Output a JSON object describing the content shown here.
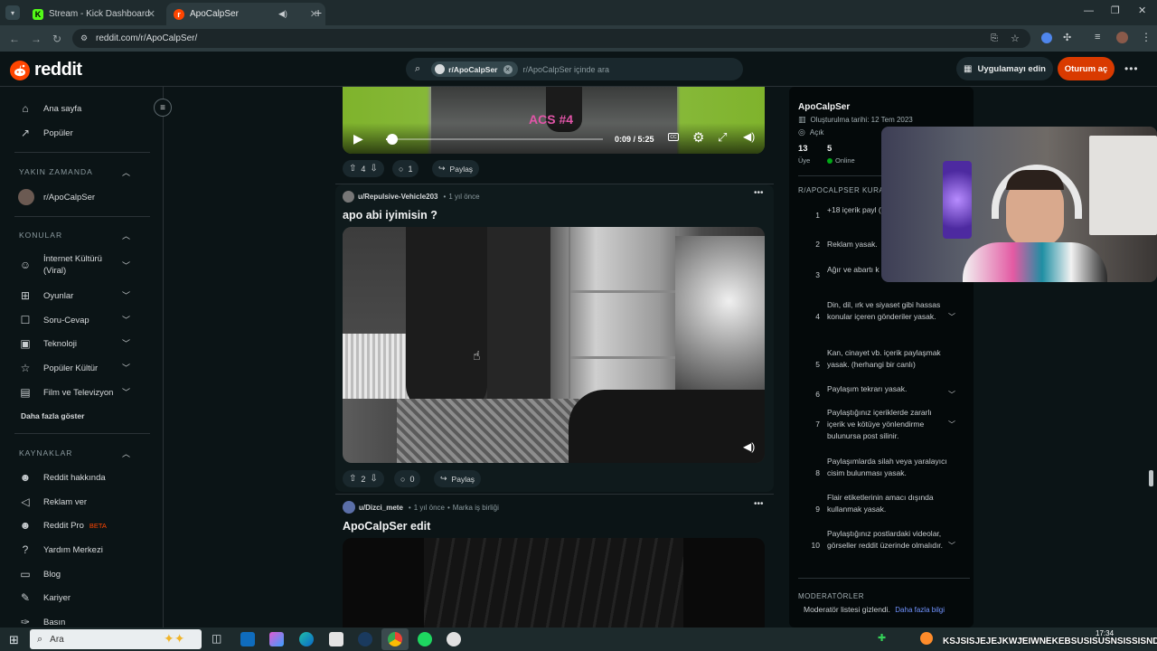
{
  "browser": {
    "tabs": [
      {
        "label": "Stream - Kick Dashboard",
        "favicon": "K"
      },
      {
        "label": "ApoCalpSer",
        "favicon": "r"
      }
    ],
    "url": "reddit.com/r/ApoCalpSer/"
  },
  "header": {
    "logo_text": "reddit",
    "search_chip": "r/ApoCalpSer",
    "search_placeholder": "r/ApoCalpSer içinde ara",
    "app_button": "Uygulamayı edin",
    "login_button": "Oturum aç"
  },
  "sidebar": {
    "top": [
      {
        "label": "Ana sayfa",
        "icon": "home-icon"
      },
      {
        "label": "Popüler",
        "icon": "popular-icon"
      }
    ],
    "recent_title": "YAKIN ZAMANDA",
    "recent": [
      {
        "label": "r/ApoCalpSer"
      }
    ],
    "topics_title": "KONULAR",
    "topics": [
      {
        "label": "İnternet Kültürü (Viral)"
      },
      {
        "label": "Oyunlar"
      },
      {
        "label": "Soru-Cevap"
      },
      {
        "label": "Teknoloji"
      },
      {
        "label": "Popüler Kültür"
      },
      {
        "label": "Film ve Televizyon"
      }
    ],
    "show_more": "Daha fazla göster",
    "resources_title": "KAYNAKLAR",
    "resources": [
      {
        "label": "Reddit hakkında"
      },
      {
        "label": "Reklam ver"
      },
      {
        "label": "Reddit Pro",
        "badge": "BETA"
      },
      {
        "label": "Yardım Merkezi"
      },
      {
        "label": "Blog"
      },
      {
        "label": "Kariyer"
      },
      {
        "label": "Basın"
      }
    ]
  },
  "feed": {
    "post1": {
      "overlay_text": "ACS #4",
      "time": "0:09 / 5:25",
      "progress": 0.03,
      "votes": "4",
      "comments": "1",
      "share": "Paylaş"
    },
    "post2": {
      "author": "u/Repulsive-Vehicle203",
      "age": "1 yıl önce",
      "title": "apo abi iyimisin ?",
      "votes": "2",
      "comments": "0",
      "share": "Paylaş"
    },
    "post3": {
      "author": "u/Dizci_mete",
      "age": "1 yıl önce",
      "tag": "Marka iş birliği",
      "title": "ApoCalpSer edit"
    }
  },
  "community": {
    "name": "ApoCalpSer",
    "created": "Oluşturulma tarihi: 12 Tem 2023",
    "visibility": "Açık",
    "members": "13",
    "members_label": "Üye",
    "online": "5",
    "online_label": "Online",
    "rules_title": "R/APOCALPSER KURALLA",
    "rules": [
      {
        "n": "1",
        "text": "+18 içerik payl (yayında ban r",
        "expand": false
      },
      {
        "n": "2",
        "text": "Reklam yasak.",
        "expand": false
      },
      {
        "n": "3",
        "text": "Ağır ve abartı k yasaktır.",
        "expand": false
      },
      {
        "n": "4",
        "text": "Din, dil, ırk ve siyaset gibi hassas konular içeren gönderiler yasak.",
        "expand": true
      },
      {
        "n": "5",
        "text": "Kan, cinayet vb. içerik paylaşmak yasak. (herhangi bir canlı)",
        "expand": false
      },
      {
        "n": "6",
        "text": "Paylaşım tekrarı yasak.",
        "expand": true
      },
      {
        "n": "7",
        "text": "Paylaştığınız içeriklerde zararlı içerik ve kötüye yönlendirme bulunursa post silinir.",
        "expand": true
      },
      {
        "n": "8",
        "text": "Paylaşımlarda silah veya yaralayıcı cisim bulunması yasak.",
        "expand": false
      },
      {
        "n": "9",
        "text": "Flair etiketlerinin amacı dışında kullanmak yasak.",
        "expand": false
      },
      {
        "n": "10",
        "text": "Paylaştığınız postlardaki videolar, görseller reddit üzerinde olmalıdır.",
        "expand": true
      }
    ],
    "moderators_title": "MODERATÖRLER",
    "moderators_text": "Moderatör listesi gizlendi.",
    "moderators_link": "Daha fazla bilgi"
  },
  "taskbar": {
    "search": "Ara",
    "clock": "17:34",
    "ticker": "KSJSISJEJEJKWJEIWNEKEBSUSISUSNSISSISNDM"
  },
  "colors": {
    "accent": "#ff4500",
    "login": "#d93a00",
    "bg": "#0b1416",
    "link": "#7193ff"
  }
}
